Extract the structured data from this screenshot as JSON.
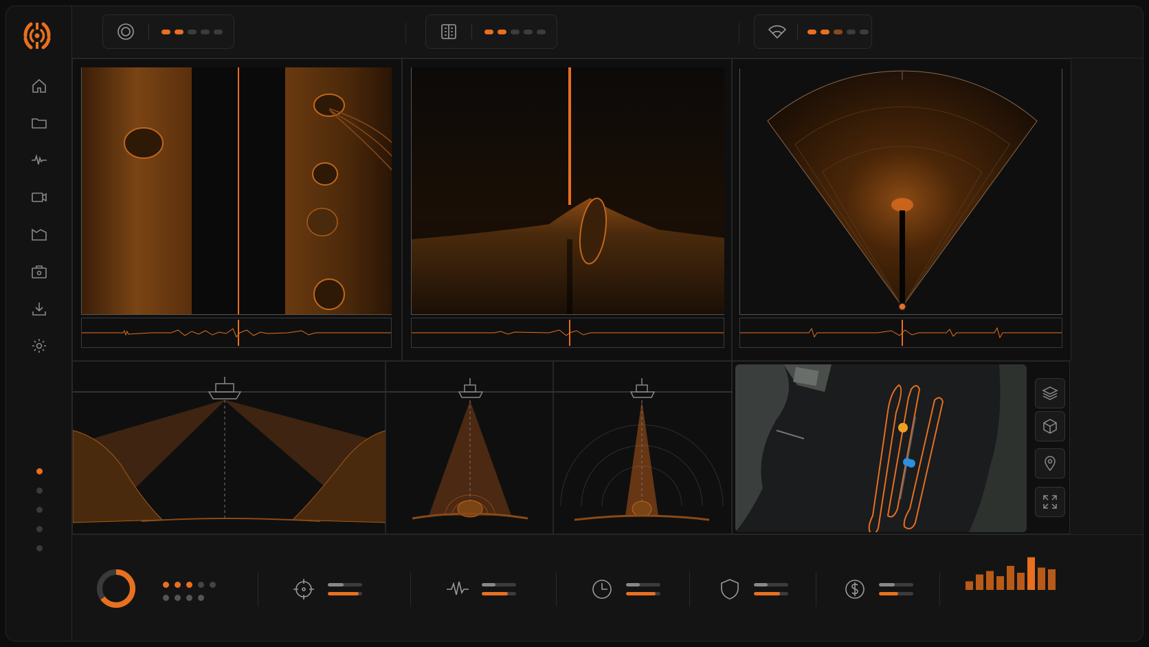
{
  "colors": {
    "accent": "#e8701f",
    "accent_dim": "#8a4a1c",
    "inactive": "#3c3c3c",
    "background": "#151515",
    "position_blue": "#2c8fe0"
  },
  "sidebar": {
    "logo": "sonar-logo-icon",
    "items": [
      {
        "icon": "home-icon"
      },
      {
        "icon": "folder-icon"
      },
      {
        "icon": "waveform-icon"
      },
      {
        "icon": "video-camera-icon"
      },
      {
        "icon": "map-icon"
      },
      {
        "icon": "toolbox-icon"
      },
      {
        "icon": "download-icon"
      },
      {
        "icon": "gear-icon"
      }
    ],
    "pager": {
      "count": 5,
      "active": 0
    }
  },
  "topbar": {
    "segments": [
      {
        "icon": "target-icon",
        "level": 2,
        "of": 5
      },
      {
        "icon": "document-icon",
        "level": 2,
        "of": 5
      },
      {
        "icon": "fan-beam-icon",
        "level": 3,
        "of": 5
      }
    ]
  },
  "views": [
    {
      "name": "side-scan",
      "icon": "side-scan-view"
    },
    {
      "name": "down-scan",
      "icon": "down-scan-view"
    },
    {
      "name": "forward-sector",
      "icon": "sector-scan-view"
    }
  ],
  "map": {
    "tools": [
      "layers-icon",
      "cube-icon",
      "location-pin-icon",
      "fullscreen-icon"
    ]
  },
  "bottombar": {
    "ring": {
      "value": 0.65
    },
    "dots": {
      "top_active": 3,
      "top_count": 5,
      "bottom_count": 4
    },
    "metrics": [
      {
        "icon": "crosshair-icon",
        "bar1": 0.45,
        "bar2": 0.9
      },
      {
        "icon": "pulse-icon",
        "bar1": 0.4,
        "bar2": 0.75
      },
      {
        "icon": "clock-icon",
        "bar1": 0.4,
        "bar2": 0.85
      },
      {
        "icon": "shield-icon",
        "bar1": 0.4,
        "bar2": 0.75
      },
      {
        "icon": "dollar-icon",
        "bar1": 0.45,
        "bar2": 0.55
      }
    ],
    "histogram": [
      0.25,
      0.45,
      0.55,
      0.4,
      0.7,
      0.5,
      0.95,
      0.65,
      0.6
    ]
  }
}
